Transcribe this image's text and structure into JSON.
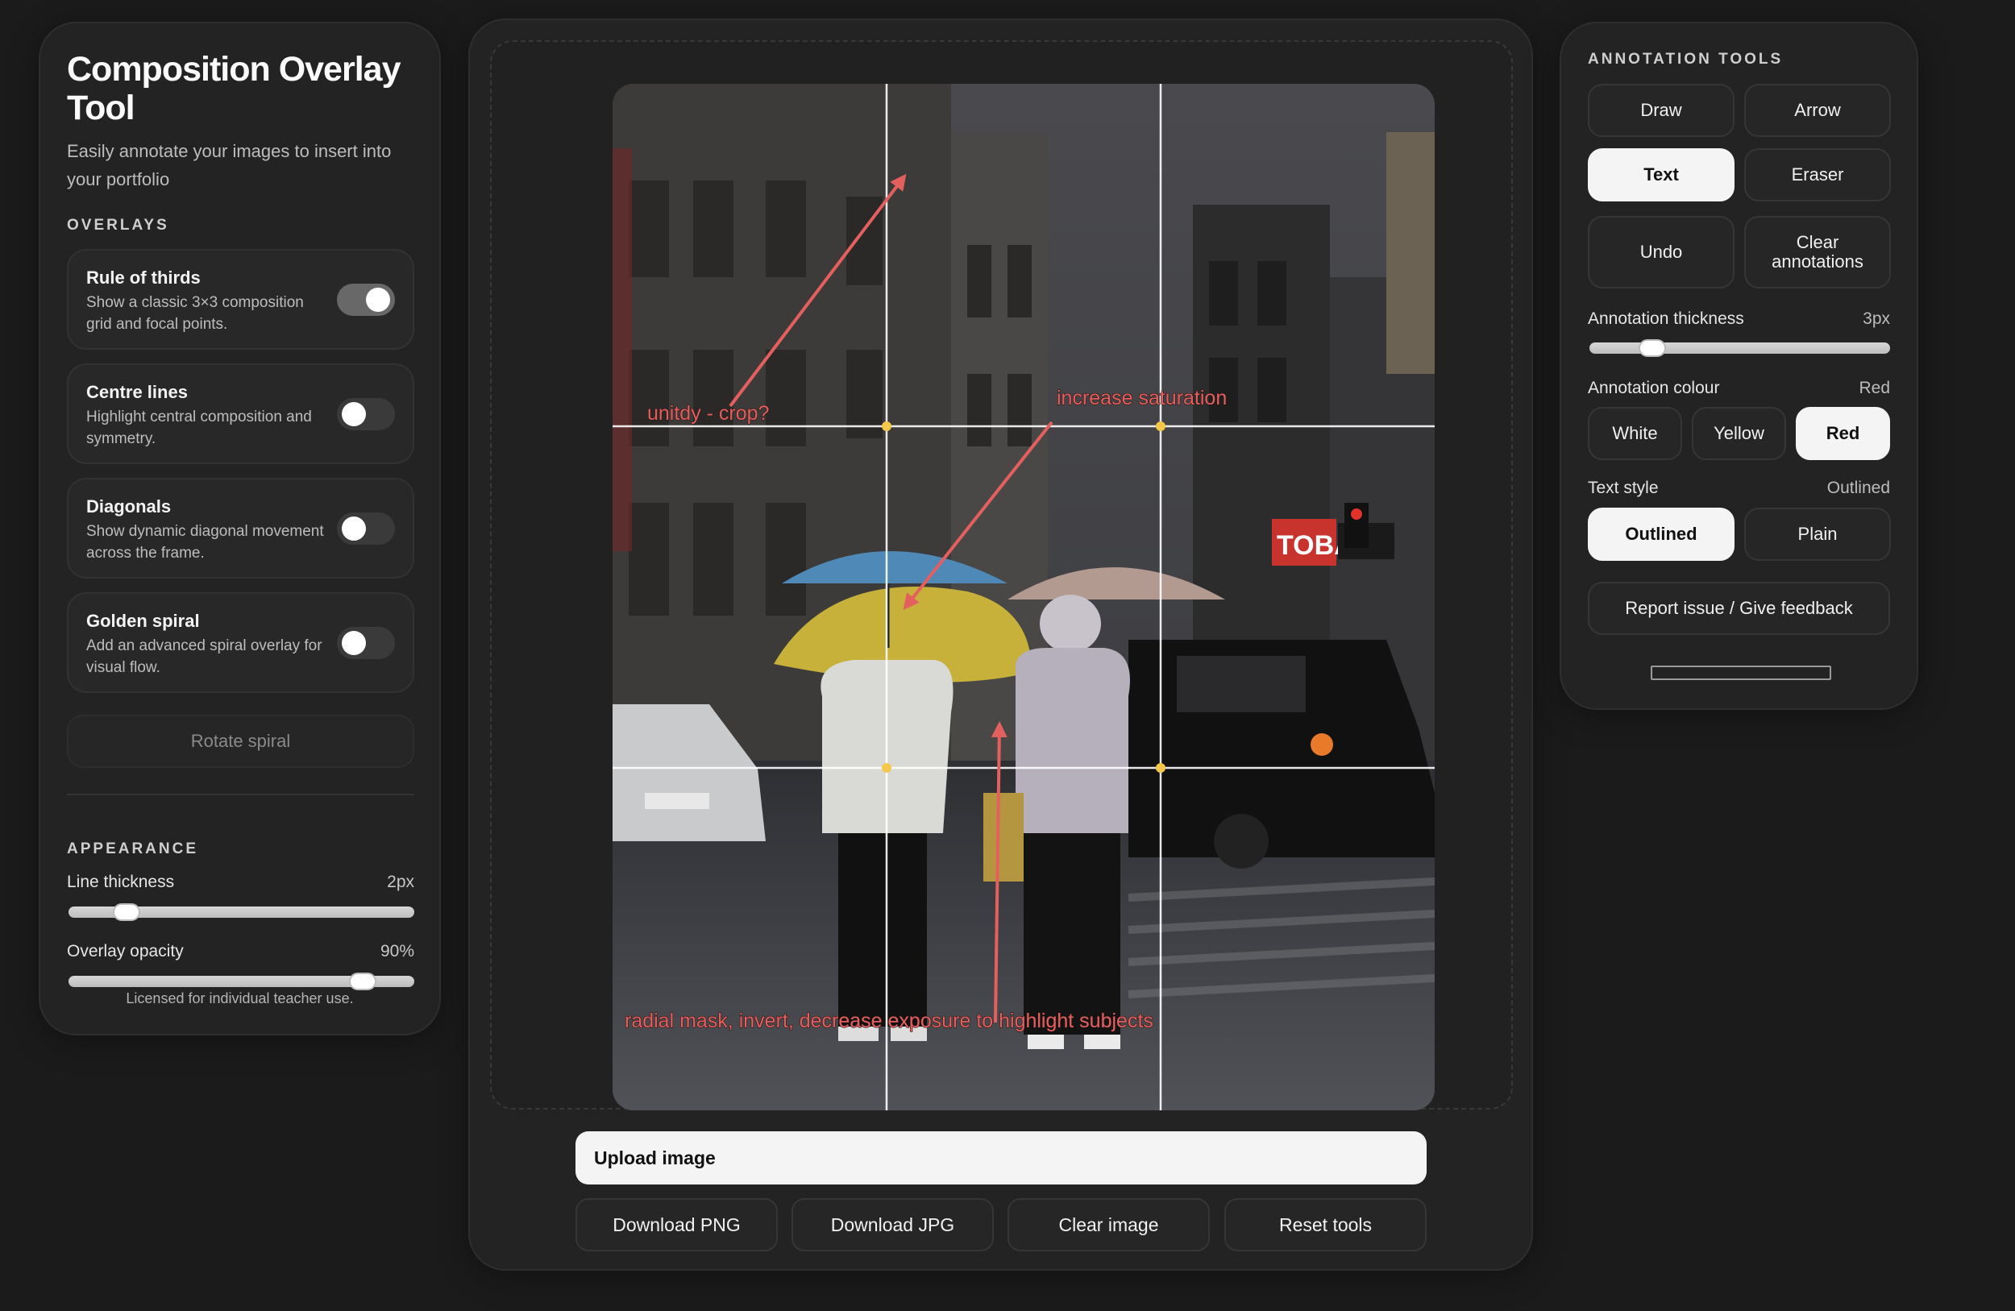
{
  "app": {
    "title": "Composition Overlay Tool",
    "subtitle": "Easily annotate your images to insert into your portfolio"
  },
  "overlays": {
    "section_label": "OVERLAYS",
    "items": [
      {
        "title": "Rule of thirds",
        "desc": "Show a classic 3×3 composition grid and focal points.",
        "on": true
      },
      {
        "title": "Centre lines",
        "desc": "Highlight central composition and symmetry.",
        "on": false
      },
      {
        "title": "Diagonals",
        "desc": "Show dynamic diagonal movement across the frame.",
        "on": false
      },
      {
        "title": "Golden spiral",
        "desc": "Add an advanced spiral overlay for visual flow.",
        "on": false
      }
    ],
    "rotate_label": "Rotate spiral"
  },
  "appearance": {
    "section_label": "APPEARANCE",
    "line_thickness_label": "Line thickness",
    "line_thickness_value": "2px",
    "line_thickness_fraction": 0.14,
    "overlay_opacity_label": "Overlay opacity",
    "overlay_opacity_value": "90%",
    "overlay_opacity_fraction": 0.88,
    "license": "Licensed for individual teacher use."
  },
  "canvas": {
    "annotations": [
      "unitdy - crop?",
      "increase saturation",
      "radial mask, invert, decrease exposure to highlight subjects"
    ],
    "annotation_color": "#e4605e",
    "grid_color": "#ffffff",
    "focal_point_color": "#f5c84a"
  },
  "actions": {
    "upload": "Upload image",
    "download_png": "Download PNG",
    "download_jpg": "Download JPG",
    "clear_image": "Clear image",
    "reset_tools": "Reset tools"
  },
  "tools": {
    "section_label": "ANNOTATION TOOLS",
    "draw": "Draw",
    "arrow": "Arrow",
    "text": "Text",
    "eraser": "Eraser",
    "undo": "Undo",
    "clear_annotations": "Clear annotations",
    "active_tool": "Text",
    "thickness_label": "Annotation thickness",
    "thickness_value": "3px",
    "thickness_fraction": 0.18,
    "colour_label": "Annotation colour",
    "colour_value": "Red",
    "colours": [
      "White",
      "Yellow",
      "Red"
    ],
    "text_style_label": "Text style",
    "text_style_value": "Outlined",
    "text_styles": [
      "Outlined",
      "Plain"
    ],
    "feedback": "Report issue / Give feedback"
  }
}
